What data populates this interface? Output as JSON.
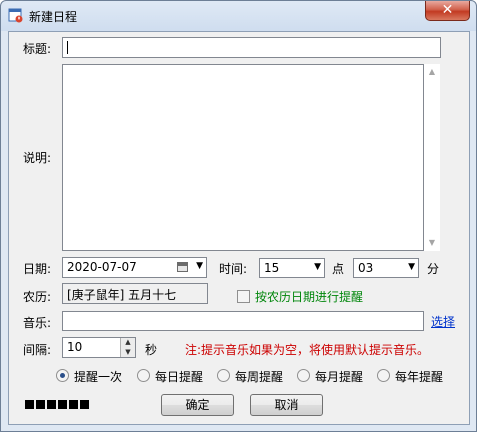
{
  "window": {
    "title": "新建日程",
    "close_glyph": "✕"
  },
  "form": {
    "title_label": "标题:",
    "title_value": "",
    "desc_label": "说明:",
    "desc_value": "",
    "date_label": "日期:",
    "date_value": "2020-07-07",
    "time_label": "时间:",
    "hour_value": "15",
    "hour_unit": "点",
    "minute_value": "03",
    "minute_unit": "分",
    "lunar_label": "农历:",
    "lunar_value": "[庚子鼠年] 五月十七",
    "lunar_checkbox_label": "按农历日期进行提醒",
    "lunar_checked": false,
    "music_label": "音乐:",
    "music_value": "",
    "music_select": "选择",
    "interval_label": "间隔:",
    "interval_value": "10",
    "interval_unit": "秒",
    "note": "注:提示音乐如果为空，将使用默认提示音乐。"
  },
  "reminders": [
    {
      "label": "提醒一次",
      "selected": true
    },
    {
      "label": "每日提醒",
      "selected": false
    },
    {
      "label": "每周提醒",
      "selected": false
    },
    {
      "label": "每月提醒",
      "selected": false
    },
    {
      "label": "每年提醒",
      "selected": false
    }
  ],
  "buttons": {
    "ok": "确定",
    "cancel": "取消"
  },
  "progress_blocks": 6,
  "colors": {
    "note": "#cc0000",
    "lunar_check": "#00860b",
    "link": "#0033cc"
  }
}
